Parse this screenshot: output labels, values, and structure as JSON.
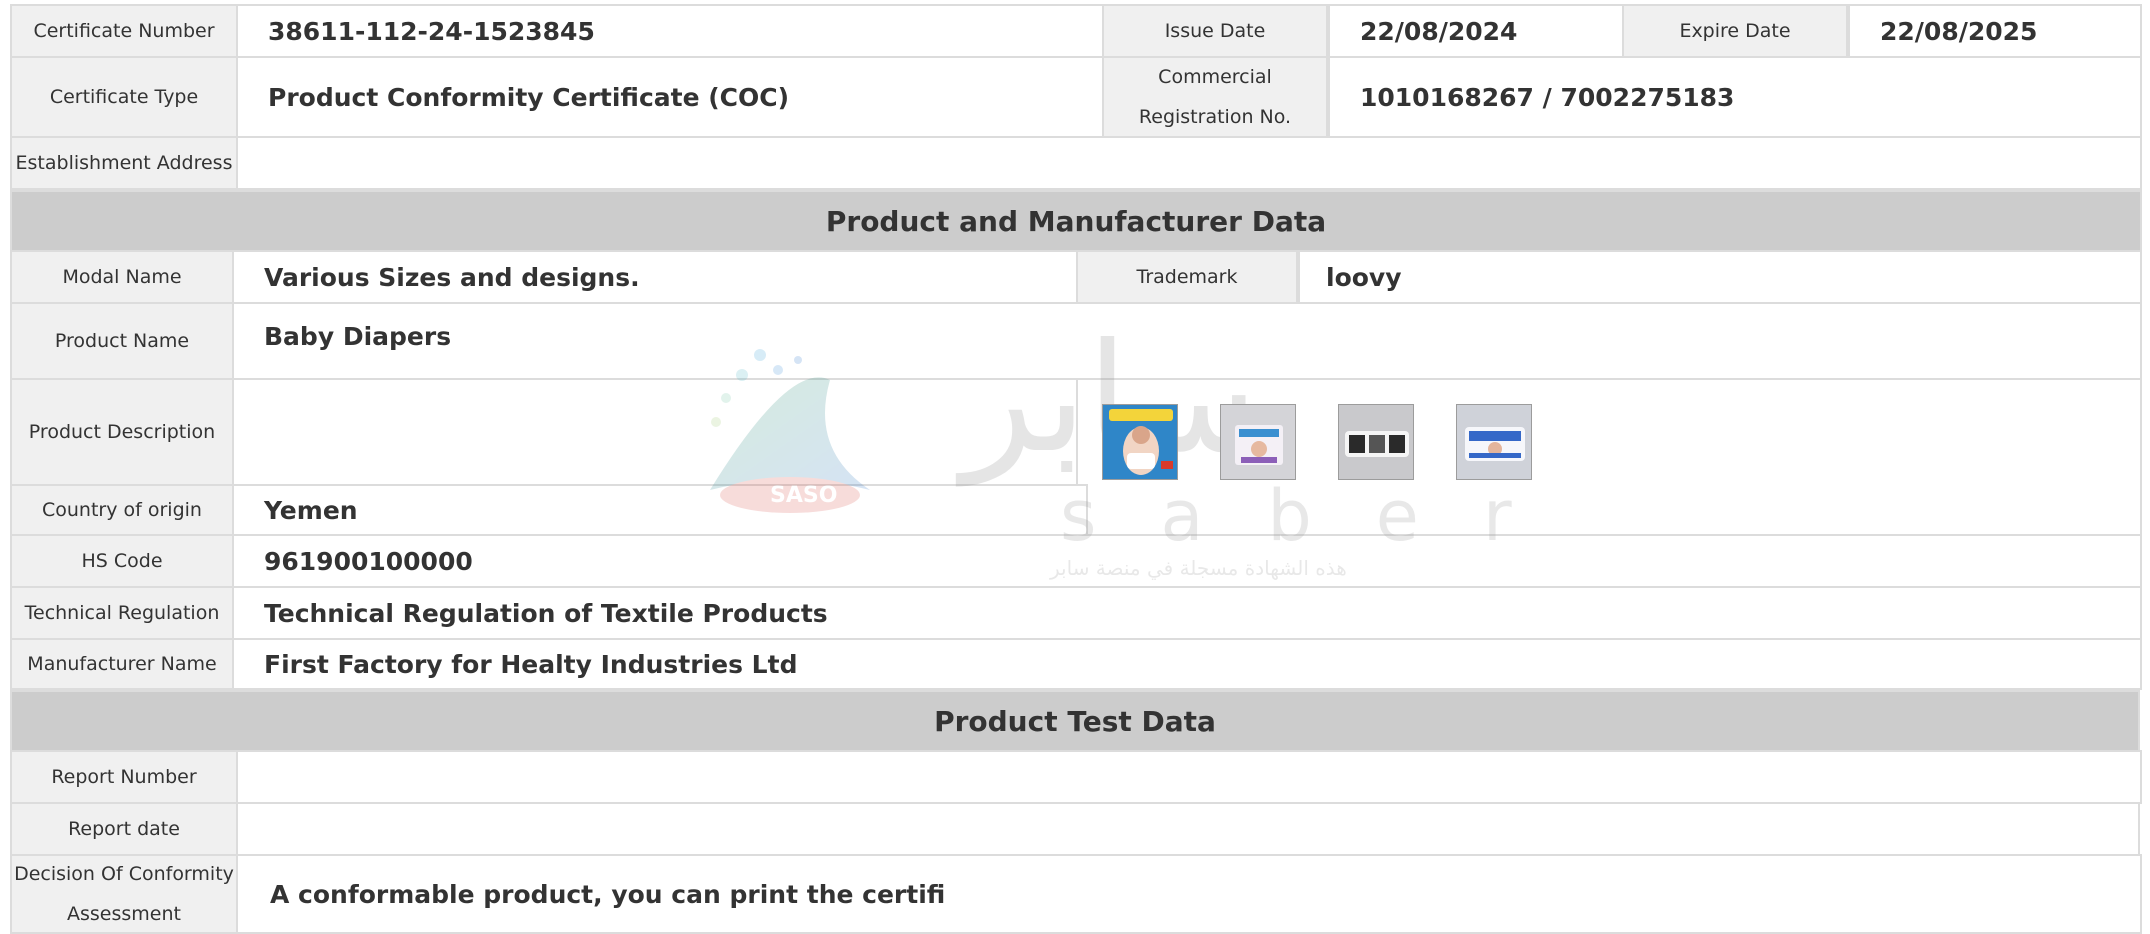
{
  "header": {
    "certificate_number_label": "Certificate Number",
    "certificate_number": "38611-112-24-1523845",
    "issue_date_label": "Issue Date",
    "issue_date": "22/08/2024",
    "expire_date_label": "Expire Date",
    "expire_date": "22/08/2025",
    "certificate_type_label": "Certificate Type",
    "certificate_type": "Product Conformity Certificate (COC)",
    "commercial_reg_label_1": "Commercial",
    "commercial_reg_label_2": "Registration No.",
    "commercial_reg": "1010168267 / 7002275183",
    "establishment_address_label": "Establishment Address",
    "establishment_address": ""
  },
  "product_section": {
    "title": "Product and Manufacturer Data",
    "modal_name_label": "Modal Name",
    "modal_name": "Various Sizes and designs.",
    "trademark_label": "Trademark",
    "trademark": "loovy",
    "product_name_label": "Product Name",
    "product_name": "Baby Diapers",
    "product_description_label": "Product Description",
    "product_description": "",
    "country_label": "Country of origin",
    "country": "Yemen",
    "hs_code_label": "HS Code",
    "hs_code": "961900100000",
    "tech_reg_label": "Technical Regulation",
    "tech_reg": "Technical Regulation of Textile Products",
    "manufacturer_label": "Manufacturer Name",
    "manufacturer": "First Factory for Healty Industries Ltd",
    "images": [
      "product-image-1",
      "product-image-2",
      "product-image-3",
      "product-image-4"
    ]
  },
  "test_section": {
    "title": "Product Test Data",
    "report_number_label": "Report Number",
    "report_number": "",
    "report_date_label": "Report date",
    "report_date": "",
    "decision_label_1": "Decision Of Conformity",
    "decision_label_2": "Assessment",
    "decision": "A conformable product, you can print the certifi"
  },
  "watermark": {
    "brand_latin": "saber",
    "brand_arabic": "سابر",
    "logo_text": "SASO",
    "tagline": "هذه الشهادة مسجلة في منصة سابر"
  },
  "colors": {
    "label_bg": "#f0f0f0",
    "section_bg": "#cccccc",
    "border": "#dcdcdc",
    "text": "#333333"
  }
}
